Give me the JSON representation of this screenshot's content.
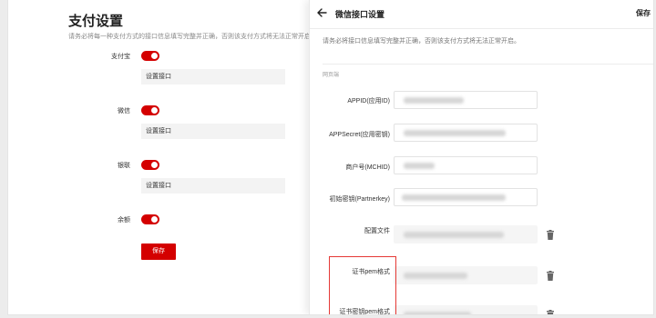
{
  "payment": {
    "title": "支付设置",
    "description": "请务必将每一种支付方式的接口信息填写完整并正确，否则该支付方式将无法正常开启。",
    "methods": [
      {
        "label": "支付宝",
        "config_label": "设置接口",
        "enabled": true
      },
      {
        "label": "微信",
        "config_label": "设置接口",
        "enabled": true
      },
      {
        "label": "银联",
        "config_label": "设置接口",
        "enabled": true
      },
      {
        "label": "余额",
        "enabled": true
      }
    ],
    "save_label": "保存"
  },
  "drawer": {
    "title": "微信接口设置",
    "save_label": "保存",
    "description": "请务必将接口信息填写完整并正确，否则该支付方式将无法正常开启。",
    "section_label": "网页端",
    "fields": [
      {
        "label": "APPID(应用ID)"
      },
      {
        "label": "APPSecret(应用密钥)"
      },
      {
        "label": "商户号(MCHID)"
      },
      {
        "label": "初始密钥(Partnerkey)"
      }
    ],
    "files": [
      {
        "label": "配置文件"
      },
      {
        "label": "证书pem格式"
      },
      {
        "label": "证书密钥pem格式"
      }
    ]
  },
  "colors": {
    "accent": "#d40000",
    "highlight": "#e53935"
  }
}
